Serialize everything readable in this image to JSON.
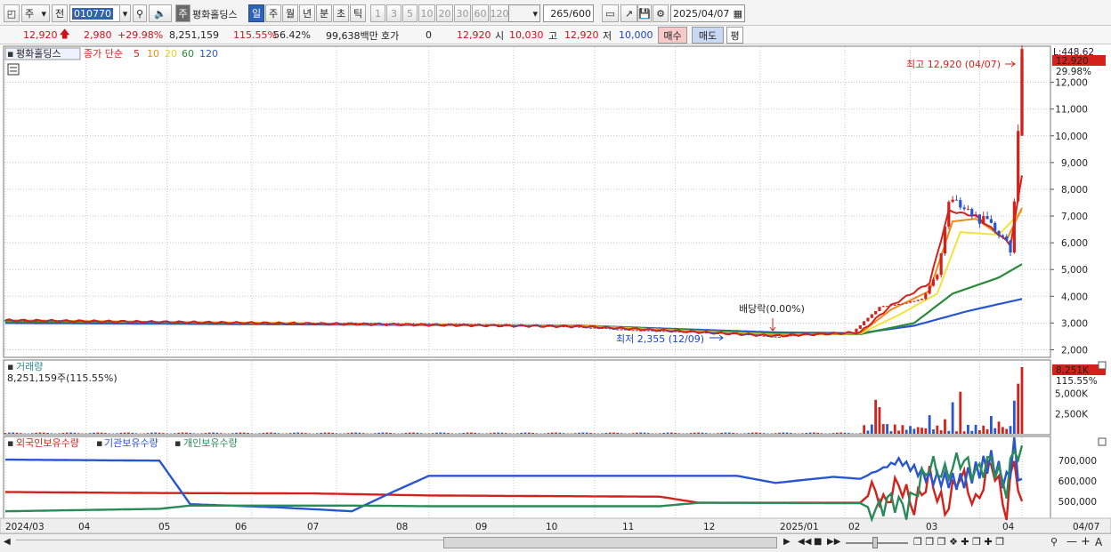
{
  "toolbar": {
    "period_type": "주",
    "prev_label": "전",
    "code": "010770",
    "stock_name": "평화홀딩스",
    "name_badge": "주",
    "periods": [
      "일",
      "주",
      "월",
      "년",
      "분",
      "초",
      "틱"
    ],
    "selected_period": "일",
    "intervals": [
      "1",
      "3",
      "5",
      "10",
      "20",
      "30",
      "60",
      "120"
    ],
    "count": "265",
    "count_max": "/600",
    "date": "2025/04/07"
  },
  "quote": {
    "price": "12,920",
    "change": "2,980",
    "change_pct": "+29.98%",
    "volume": "8,251,159",
    "volume_ratio": "115.55%",
    "turnover_pct": "56.42%",
    "amount": "99,638백만",
    "hoga_label": "호가",
    "hoga_value": "0",
    "hoga_price": "12,920",
    "open_label": "시",
    "open": "10,030",
    "high_label": "고",
    "high": "12,920",
    "low_label": "저",
    "low": "10,000",
    "buy_label": "매수",
    "sell_label": "매도",
    "eval_label": "평"
  },
  "price_panel": {
    "name": "평화홀딩스",
    "ma_title": "종가 단순",
    "ma_periods": [
      "5",
      "10",
      "20",
      "60",
      "120"
    ],
    "ma_colors": [
      "#d2221b",
      "#f08a1c",
      "#f2e33a",
      "#2a8a3a",
      "#2a55d0"
    ],
    "top_right_label": "L:448.62",
    "last_price_tag": "12,920",
    "last_pct_tag": "29.98%",
    "high_annotation": "최고 12,920 (04/07)",
    "low_annotation": "최저 2,355 (12/09)",
    "dividend_annotation": "배당락(0.00%)"
  },
  "volume_panel": {
    "title": "거래량",
    "value_text": "8,251,159주(115.55%)",
    "last_tag": "8,251K",
    "last_pct": "115.55%"
  },
  "holdings_panel": {
    "series_labels": [
      "외국인보유수량",
      "기관보유수량",
      "개인보유수량"
    ],
    "series_colors": [
      "#d2221b",
      "#2a55d0",
      "#2a8a5a"
    ]
  },
  "chart_data": [
    {
      "type": "candlestick",
      "title": "평화홀딩스",
      "ylim": [
        2000,
        12920
      ],
      "y_ticks": [
        2000,
        3000,
        4000,
        5000,
        6000,
        7000,
        8000,
        9000,
        10000,
        11000,
        12000
      ],
      "y_tick_labels": [
        "2,000",
        "3,000",
        "4,000",
        "5,000",
        "6,000",
        "7,000",
        "8,000",
        "9,000",
        "10,000",
        "11,000",
        "12,000"
      ],
      "x_tick_labels": [
        "2024/03",
        "04",
        "05",
        "06",
        "07",
        "08",
        "09",
        "10",
        "11",
        "12",
        "2025/01",
        "02",
        "03",
        "04",
        "04/07"
      ],
      "price_path": [
        [
          0,
          3100
        ],
        [
          30,
          3050
        ],
        [
          60,
          2980
        ],
        [
          90,
          3000
        ],
        [
          120,
          2950
        ],
        [
          150,
          2850
        ],
        [
          160,
          2750
        ],
        [
          190,
          2600
        ],
        [
          200,
          2480
        ],
        [
          210,
          2600
        ],
        [
          220,
          2650
        ],
        [
          227,
          3600
        ],
        [
          232,
          3700
        ],
        [
          238,
          3900
        ],
        [
          242,
          4800
        ],
        [
          245,
          7600
        ],
        [
          248,
          7300
        ],
        [
          252,
          7000
        ],
        [
          256,
          6600
        ],
        [
          259,
          6300
        ],
        [
          261,
          5800
        ],
        [
          262,
          7500
        ],
        [
          263,
          9900
        ],
        [
          264,
          12920
        ]
      ],
      "ma_paths": {
        "5": [
          [
            0,
            3100
          ],
          [
            150,
            2870
          ],
          [
            200,
            2520
          ],
          [
            222,
            2650
          ],
          [
            230,
            3650
          ],
          [
            240,
            4500
          ],
          [
            245,
            7200
          ],
          [
            252,
            7000
          ],
          [
            259,
            6200
          ],
          [
            261,
            5900
          ],
          [
            264,
            8500
          ]
        ],
        "10": [
          [
            0,
            3100
          ],
          [
            150,
            2880
          ],
          [
            200,
            2540
          ],
          [
            222,
            2620
          ],
          [
            230,
            3500
          ],
          [
            240,
            4200
          ],
          [
            246,
            6800
          ],
          [
            252,
            6900
          ],
          [
            260,
            6100
          ],
          [
            264,
            7300
          ]
        ],
        "20": [
          [
            0,
            3100
          ],
          [
            150,
            2890
          ],
          [
            200,
            2560
          ],
          [
            222,
            2600
          ],
          [
            232,
            3300
          ],
          [
            242,
            4100
          ],
          [
            248,
            6400
          ],
          [
            258,
            6300
          ],
          [
            264,
            7200
          ]
        ],
        "60": [
          [
            0,
            3050
          ],
          [
            150,
            2900
          ],
          [
            200,
            2600
          ],
          [
            222,
            2580
          ],
          [
            236,
            3000
          ],
          [
            246,
            4100
          ],
          [
            258,
            4700
          ],
          [
            264,
            5200
          ]
        ],
        "120": [
          [
            0,
            3000
          ],
          [
            150,
            2900
          ],
          [
            200,
            2650
          ],
          [
            222,
            2620
          ],
          [
            236,
            2900
          ],
          [
            250,
            3450
          ],
          [
            264,
            3900
          ]
        ]
      }
    },
    {
      "type": "bar",
      "title": "거래량",
      "y_tick_labels": [
        "2,500K",
        "5,000K"
      ],
      "ylim": [
        0,
        8251159
      ],
      "spikes": [
        [
          226,
          4200000
        ],
        [
          227,
          3300000
        ],
        [
          228,
          1200000
        ],
        [
          240,
          2300000
        ],
        [
          244,
          1800000
        ],
        [
          246,
          3900000
        ],
        [
          248,
          5200000
        ],
        [
          250,
          1100000
        ],
        [
          256,
          2200000
        ],
        [
          258,
          1500000
        ],
        [
          262,
          4100000
        ],
        [
          263,
          6200000
        ],
        [
          264,
          8251159
        ]
      ]
    },
    {
      "type": "line",
      "title": "외국인보유수량 / 기관보유수량 / 개인보유수량",
      "y_tick_labels": [
        "500,000",
        "600,000",
        "700,000"
      ],
      "ylim": [
        420000,
        780000
      ],
      "series": [
        {
          "name": "외국인보유수량",
          "points": [
            [
              0,
              545000
            ],
            [
              40,
              540000
            ],
            [
              80,
              538000
            ],
            [
              110,
              528000
            ],
            [
              170,
              522000
            ],
            [
              180,
              492000
            ],
            [
              222,
              492000
            ],
            [
              226,
              560000
            ],
            [
              228,
              480000
            ],
            [
              232,
              590000
            ],
            [
              236,
              470000
            ],
            [
              240,
              620000
            ],
            [
              244,
              450000
            ],
            [
              248,
              640000
            ],
            [
              252,
              480000
            ],
            [
              256,
              700000
            ],
            [
              260,
              440000
            ],
            [
              262,
              720000
            ],
            [
              264,
              445000
            ]
          ]
        },
        {
          "name": "기관보유수량",
          "points": [
            [
              0,
              705000
            ],
            [
              40,
              700000
            ],
            [
              48,
              485000
            ],
            [
              70,
              470000
            ],
            [
              90,
              450000
            ],
            [
              100,
              540000
            ],
            [
              110,
              625000
            ],
            [
              190,
              625000
            ],
            [
              200,
              590000
            ],
            [
              215,
              620000
            ],
            [
              222,
              610000
            ],
            [
              232,
              700000
            ],
            [
              240,
              615000
            ],
            [
              248,
              595000
            ],
            [
              256,
              700000
            ],
            [
              260,
              590000
            ],
            [
              262,
              760000
            ],
            [
              264,
              555000
            ]
          ]
        },
        {
          "name": "개인보유수량",
          "points": [
            [
              0,
              450000
            ],
            [
              40,
              462000
            ],
            [
              48,
              478000
            ],
            [
              90,
              478000
            ],
            [
              110,
              475000
            ],
            [
              170,
              475000
            ],
            [
              180,
              492000
            ],
            [
              222,
              490000
            ],
            [
              226,
              450000
            ],
            [
              230,
              510000
            ],
            [
              234,
              460000
            ],
            [
              240,
              680000
            ],
            [
              244,
              630000
            ],
            [
              248,
              710000
            ],
            [
              252,
              640000
            ],
            [
              256,
              700000
            ],
            [
              260,
              560000
            ],
            [
              262,
              760000
            ],
            [
              264,
              720000
            ]
          ]
        }
      ]
    }
  ]
}
